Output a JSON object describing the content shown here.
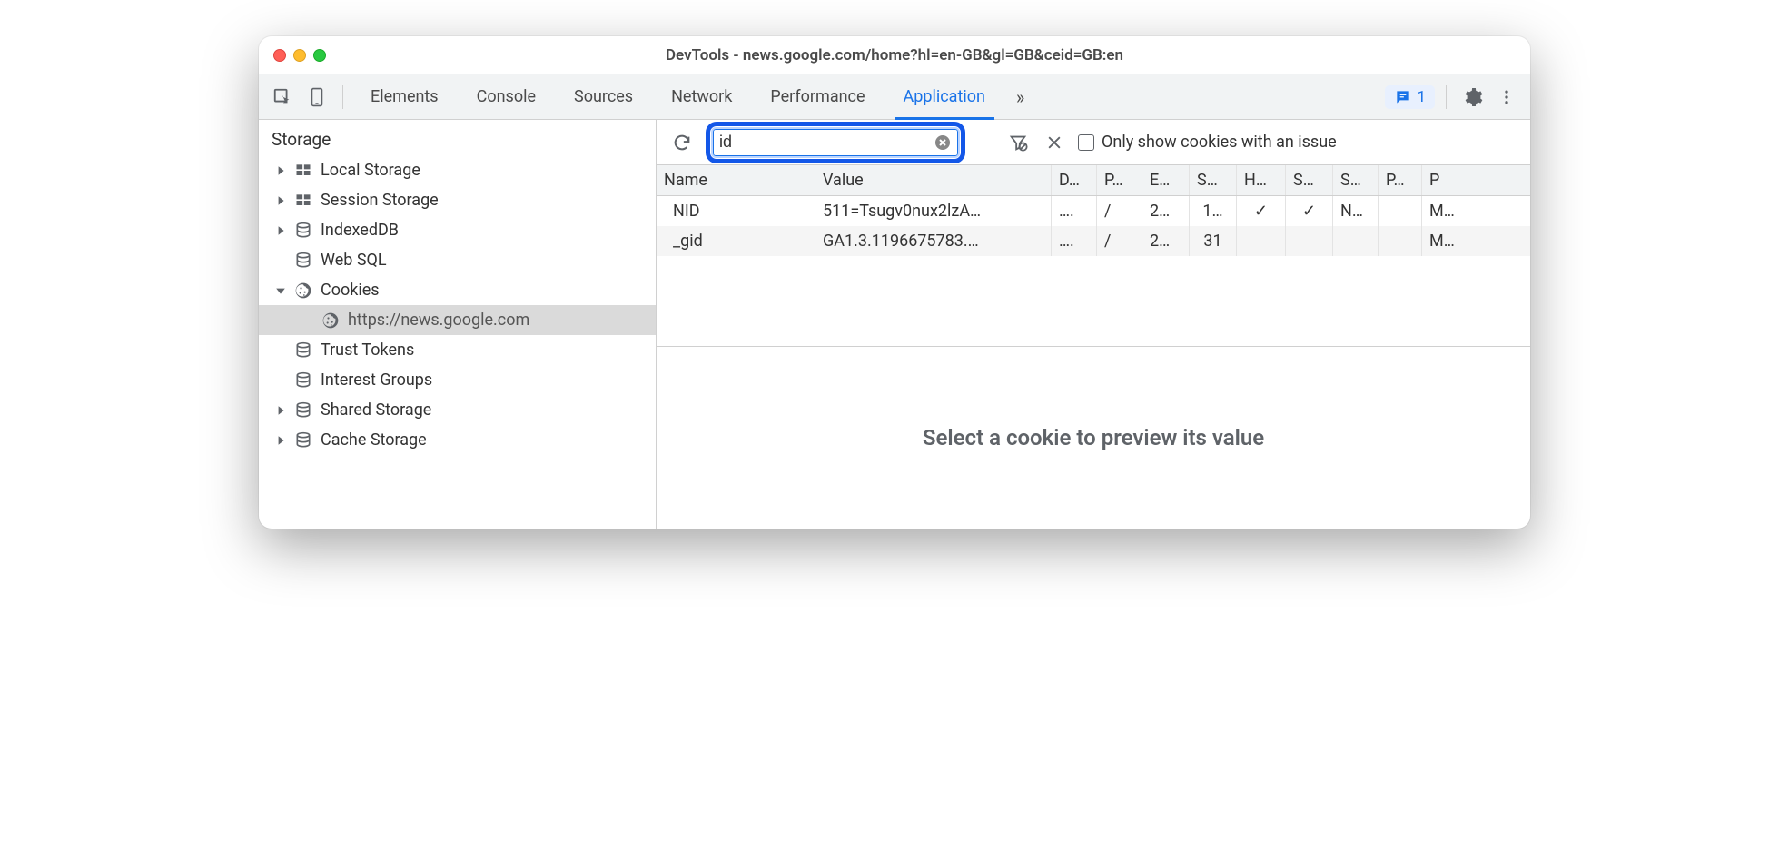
{
  "window": {
    "title": "DevTools - news.google.com/home?hl=en-GB&gl=GB&ceid=GB:en"
  },
  "tabs": {
    "items": [
      "Elements",
      "Console",
      "Sources",
      "Network",
      "Performance",
      "Application"
    ],
    "active": "Application",
    "overflow_icon": "»",
    "message_count": "1"
  },
  "sidebar": {
    "heading": "Storage",
    "items": [
      {
        "label": "Local Storage",
        "icon": "grid",
        "arrow": "right"
      },
      {
        "label": "Session Storage",
        "icon": "grid",
        "arrow": "right"
      },
      {
        "label": "IndexedDB",
        "icon": "database",
        "arrow": "right"
      },
      {
        "label": "Web SQL",
        "icon": "database",
        "arrow": "none"
      },
      {
        "label": "Cookies",
        "icon": "cookie",
        "arrow": "down"
      },
      {
        "label": "https://news.google.com",
        "icon": "cookie",
        "arrow": "none",
        "level": 2,
        "selected": true
      },
      {
        "label": "Trust Tokens",
        "icon": "database",
        "arrow": "none"
      },
      {
        "label": "Interest Groups",
        "icon": "database",
        "arrow": "none"
      },
      {
        "label": "Shared Storage",
        "icon": "database",
        "arrow": "right"
      },
      {
        "label": "Cache Storage",
        "icon": "database",
        "arrow": "right"
      }
    ]
  },
  "toolbar": {
    "filter_value": "id",
    "checkbox_label": "Only show cookies with an issue"
  },
  "table": {
    "headers": [
      "Name",
      "Value",
      "D…",
      "P…",
      "E…",
      "S…",
      "H…",
      "S…",
      "S…",
      "P…",
      "P"
    ],
    "rows": [
      {
        "name": "NID",
        "value": "511=Tsugv0nux2lzA…",
        "d": "….",
        "p": "/",
        "e": "2…",
        "s": "1…",
        "h": "✓",
        "s2": "✓",
        "s3": "N…",
        "p2": "",
        "p3": "M…"
      },
      {
        "name": "_gid",
        "value": "GA1.3.1196675783.…",
        "d": "….",
        "p": "/",
        "e": "2…",
        "s": "31",
        "h": "",
        "s2": "",
        "s3": "",
        "p2": "",
        "p3": "M…"
      }
    ]
  },
  "preview": {
    "empty_text": "Select a cookie to preview its value"
  }
}
